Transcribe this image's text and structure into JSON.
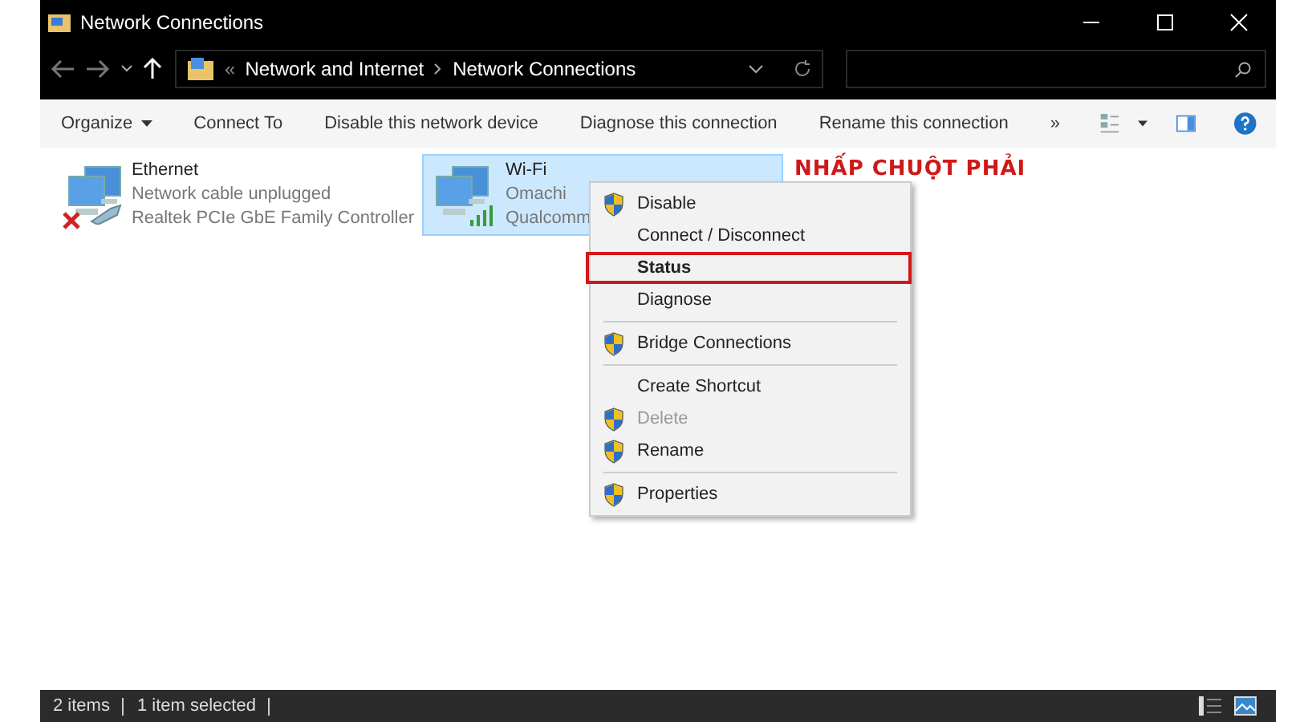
{
  "window": {
    "title": "Network Connections"
  },
  "address": {
    "prefix": "«",
    "path": [
      {
        "label": "Network and Internet"
      },
      {
        "label": "Network Connections"
      }
    ]
  },
  "toolbar": {
    "items": [
      {
        "label": "Organize",
        "kind": "menu"
      },
      {
        "label": "Connect To",
        "kind": "button"
      },
      {
        "label": "Disable this network device",
        "kind": "button"
      },
      {
        "label": "Diagnose this connection",
        "kind": "button"
      },
      {
        "label": "Rename this connection",
        "kind": "button"
      }
    ],
    "overflow": "»"
  },
  "connections": [
    {
      "name": "Ethernet",
      "status": "Network cable unplugged",
      "device": "Realtek PCIe GbE Family Controller",
      "kind": "ethernet",
      "connected": false,
      "selected": false
    },
    {
      "name": "Wi-Fi",
      "status": "Omachi",
      "device": "Qualcomm",
      "kind": "wifi",
      "connected": true,
      "selected": true
    }
  ],
  "context_menu": {
    "items": [
      {
        "kind": "command",
        "label": "Disable",
        "shield": true,
        "disabled": false,
        "default": false
      },
      {
        "kind": "command",
        "label": "Connect / Disconnect",
        "disabled": false,
        "default": false
      },
      {
        "kind": "command",
        "label": "Status",
        "disabled": false,
        "default": true,
        "highlighted": true
      },
      {
        "kind": "command",
        "label": "Diagnose",
        "disabled": false,
        "default": false
      },
      {
        "kind": "separator"
      },
      {
        "kind": "command",
        "label": "Bridge Connections",
        "shield": true,
        "disabled": false,
        "default": false
      },
      {
        "kind": "separator"
      },
      {
        "kind": "command",
        "label": "Create Shortcut",
        "disabled": false,
        "default": false
      },
      {
        "kind": "command",
        "label": "Delete",
        "shield": true,
        "disabled": true,
        "default": false
      },
      {
        "kind": "command",
        "label": "Rename",
        "shield": true,
        "disabled": false,
        "default": false
      },
      {
        "kind": "separator"
      },
      {
        "kind": "command",
        "label": "Properties",
        "shield": true,
        "disabled": false,
        "default": false
      }
    ]
  },
  "annotation": {
    "text": "NHẤP CHUỘT PHẢI"
  },
  "status_bar": {
    "item_count": "2 items",
    "selection": "1 item selected"
  }
}
